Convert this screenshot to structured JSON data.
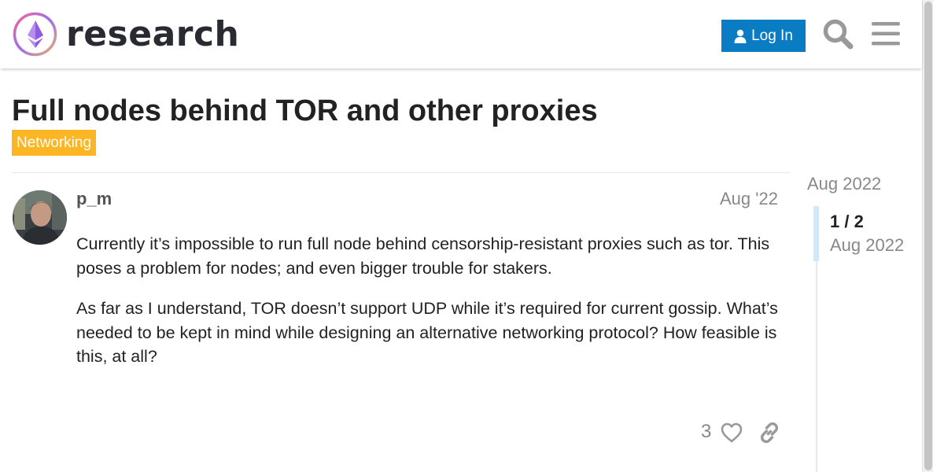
{
  "header": {
    "site_name": "research",
    "login_label": "Log In",
    "icons": [
      "search-icon",
      "hamburger-menu-icon",
      "user-icon"
    ]
  },
  "topic": {
    "title": "Full nodes behind TOR and other proxies",
    "category": "Networking",
    "category_color": "#fcb523"
  },
  "post": {
    "username": "p_m",
    "date": "Aug '22",
    "paragraphs": [
      "Currently it’s impossible to run full node behind censorship-resistant proxies such as tor. This poses a problem for nodes; and even bigger trouble for stakers.",
      "As far as I understand, TOR doesn’t support UDP while it’s required for current gossip. What’s needed to be kept in mind while designing an alternative networking protocol? How feasible is this, at all?"
    ],
    "like_count": "3"
  },
  "timeline": {
    "top_date": "Aug 2022",
    "position": "1 / 2",
    "position_date": "Aug 2022"
  },
  "colors": {
    "accent": "#0a7cc4",
    "muted_text": "#888888"
  }
}
